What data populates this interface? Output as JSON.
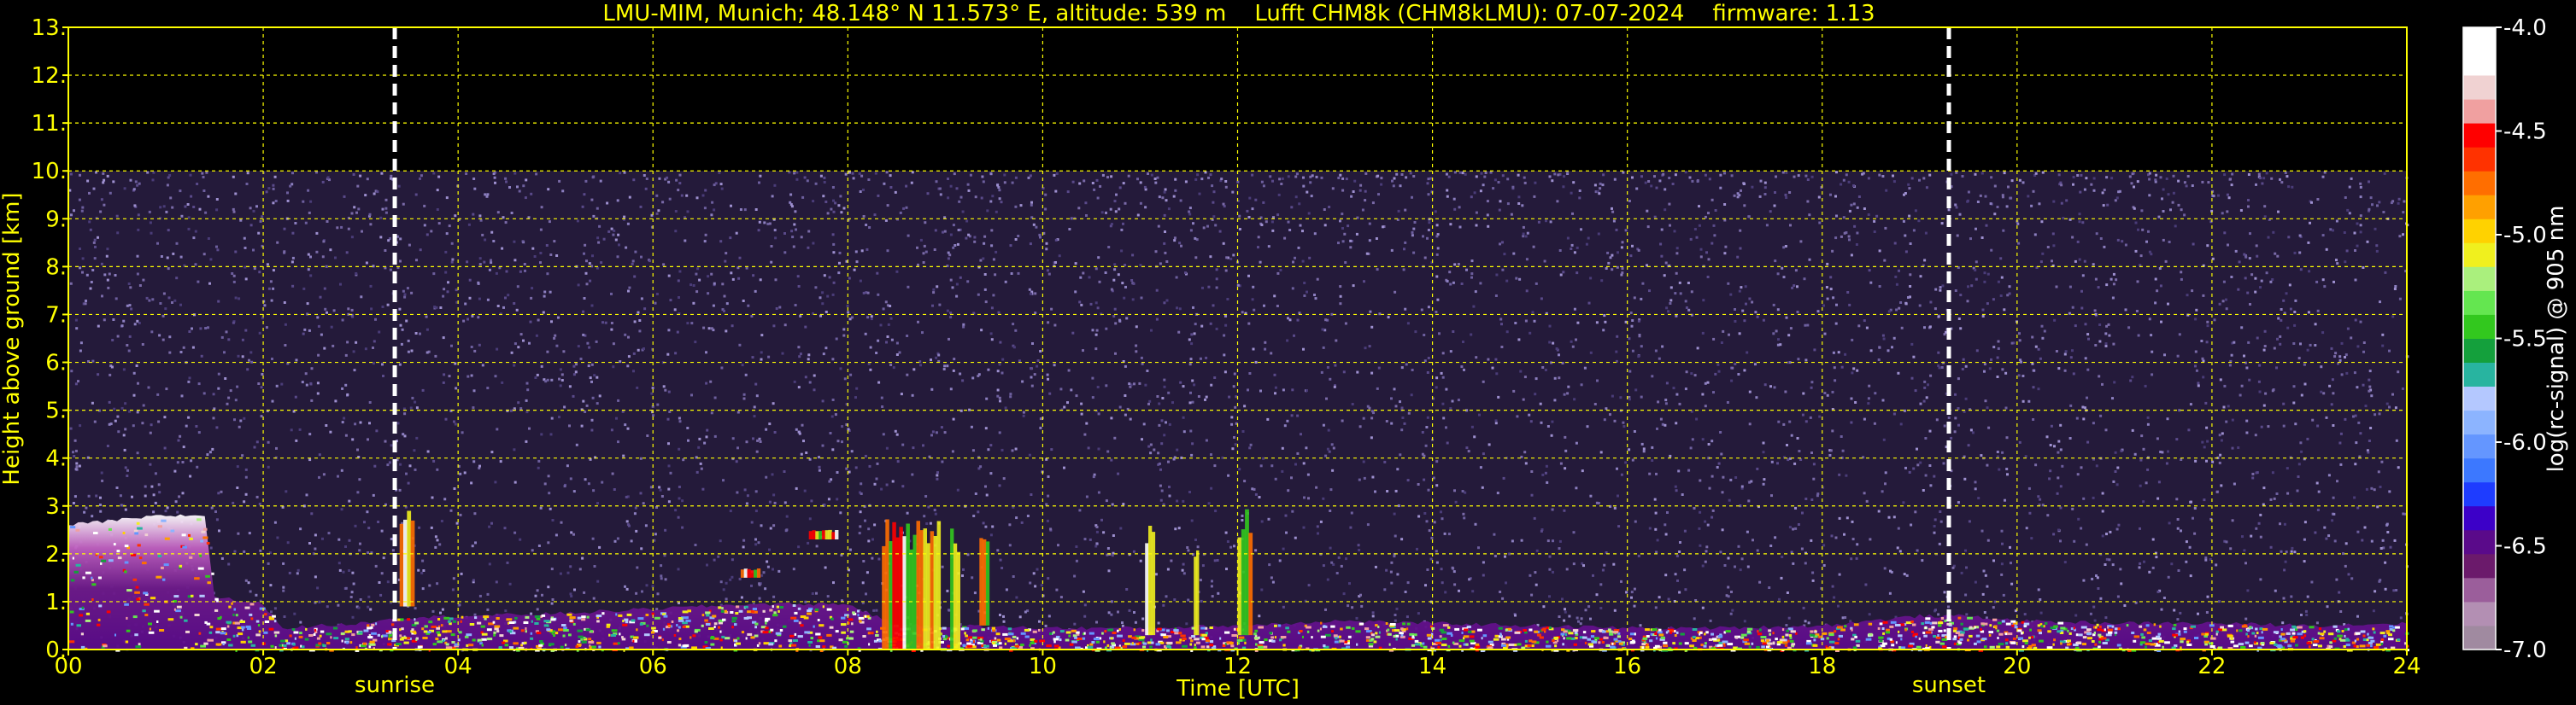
{
  "chart_data": {
    "type": "heatmap",
    "title": "LMU-MIM, Munich; 48.148° N 11.573° E, altitude: 539 m    Lufft CHM8k (CHM8kLMU): 07-07-2024    firmware: 1.13",
    "xlabel": "Time [UTC]",
    "ylabel": "Height above ground [km]",
    "colorbar_label": "log(rc-signal) @ 905 nm",
    "xlim": [
      0,
      24
    ],
    "ylim": [
      0,
      13
    ],
    "x_ticks": [
      0,
      2,
      4,
      6,
      8,
      10,
      12,
      14,
      16,
      18,
      20,
      22,
      24
    ],
    "x_tick_labels": [
      "00",
      "02",
      "04",
      "06",
      "08",
      "10",
      "12",
      "14",
      "16",
      "18",
      "20",
      "22",
      "24"
    ],
    "y_ticks": [
      0,
      1,
      2,
      3,
      4,
      5,
      6,
      7,
      8,
      9,
      10,
      11,
      12,
      13
    ],
    "y_tick_labels": [
      "0.",
      "1.",
      "2.",
      "3.",
      "4.",
      "5.",
      "6.",
      "7.",
      "8.",
      "9.",
      "10.",
      "11.",
      "12.",
      "13."
    ],
    "colorbar_range": [
      -7.0,
      -4.0
    ],
    "colorbar_ticks": [
      -7.0,
      -6.5,
      -6.0,
      -5.5,
      -5.0,
      -4.5,
      -4.0
    ],
    "colorbar_tick_labels": [
      "-7.0",
      "-6.5",
      "-6.0",
      "-5.5",
      "-5.0",
      "-4.5",
      "-4.0"
    ],
    "colormap": [
      "#a08aa0",
      "#b38fb3",
      "#9b5e9b",
      "#6b1a6b",
      "#5a0a8a",
      "#3c00c8",
      "#1e3cff",
      "#3c78ff",
      "#6496ff",
      "#8cb4ff",
      "#b4c8ff",
      "#28b4a0",
      "#14a03c",
      "#32c81e",
      "#64e650",
      "#aaf07d",
      "#f0f01e",
      "#ffd200",
      "#ffa000",
      "#ff6e00",
      "#ff3200",
      "#ff0000",
      "#f0a0a0",
      "#f0d2d2",
      "#ffffff",
      "#ffffff"
    ],
    "grid": true,
    "signal_top_km": 10.0,
    "markers": [
      {
        "label": "sunrise",
        "time": 3.35
      },
      {
        "label": "sunset",
        "time": 19.3
      }
    ],
    "boundary_layer_km": {
      "time": [
        0,
        0.5,
        1.0,
        1.4,
        1.5,
        2.0,
        2.2,
        3.0,
        3.3,
        4.0,
        5.0,
        6.0,
        7.0,
        8.0,
        8.5,
        9.0,
        10.0,
        11.0,
        12.0,
        13.0,
        14.0,
        15.0,
        16.0,
        17.0,
        18.0,
        19.0,
        19.5,
        20.0,
        21.0,
        22.0,
        23.0,
        24.0
      ],
      "height": [
        2.6,
        2.7,
        2.8,
        2.8,
        1.1,
        0.95,
        0.45,
        0.55,
        0.65,
        0.7,
        0.75,
        0.85,
        0.95,
        0.95,
        0.5,
        0.5,
        0.45,
        0.45,
        0.5,
        0.6,
        0.55,
        0.5,
        0.45,
        0.45,
        0.5,
        0.7,
        0.7,
        0.6,
        0.55,
        0.55,
        0.5,
        0.55
      ]
    },
    "cloud_features": [
      {
        "t0": 8.35,
        "t1": 8.95,
        "h0": 0.0,
        "h1": 2.75
      },
      {
        "t0": 9.05,
        "t1": 9.15,
        "h0": 0.0,
        "h1": 2.7
      },
      {
        "t0": 9.35,
        "t1": 9.45,
        "h0": 0.5,
        "h1": 2.6
      },
      {
        "t0": 11.05,
        "t1": 11.15,
        "h0": 0.3,
        "h1": 2.7
      },
      {
        "t0": 11.55,
        "t1": 11.6,
        "h0": 0.3,
        "h1": 2.1
      },
      {
        "t0": 12.0,
        "t1": 12.15,
        "h0": 0.3,
        "h1": 2.95
      },
      {
        "t0": 7.6,
        "t1": 7.9,
        "h0": 2.3,
        "h1": 2.5
      },
      {
        "t0": 6.9,
        "t1": 7.1,
        "h0": 1.5,
        "h1": 1.7
      },
      {
        "t0": 3.4,
        "t1": 3.55,
        "h0": 0.9,
        "h1": 3.1
      }
    ]
  }
}
